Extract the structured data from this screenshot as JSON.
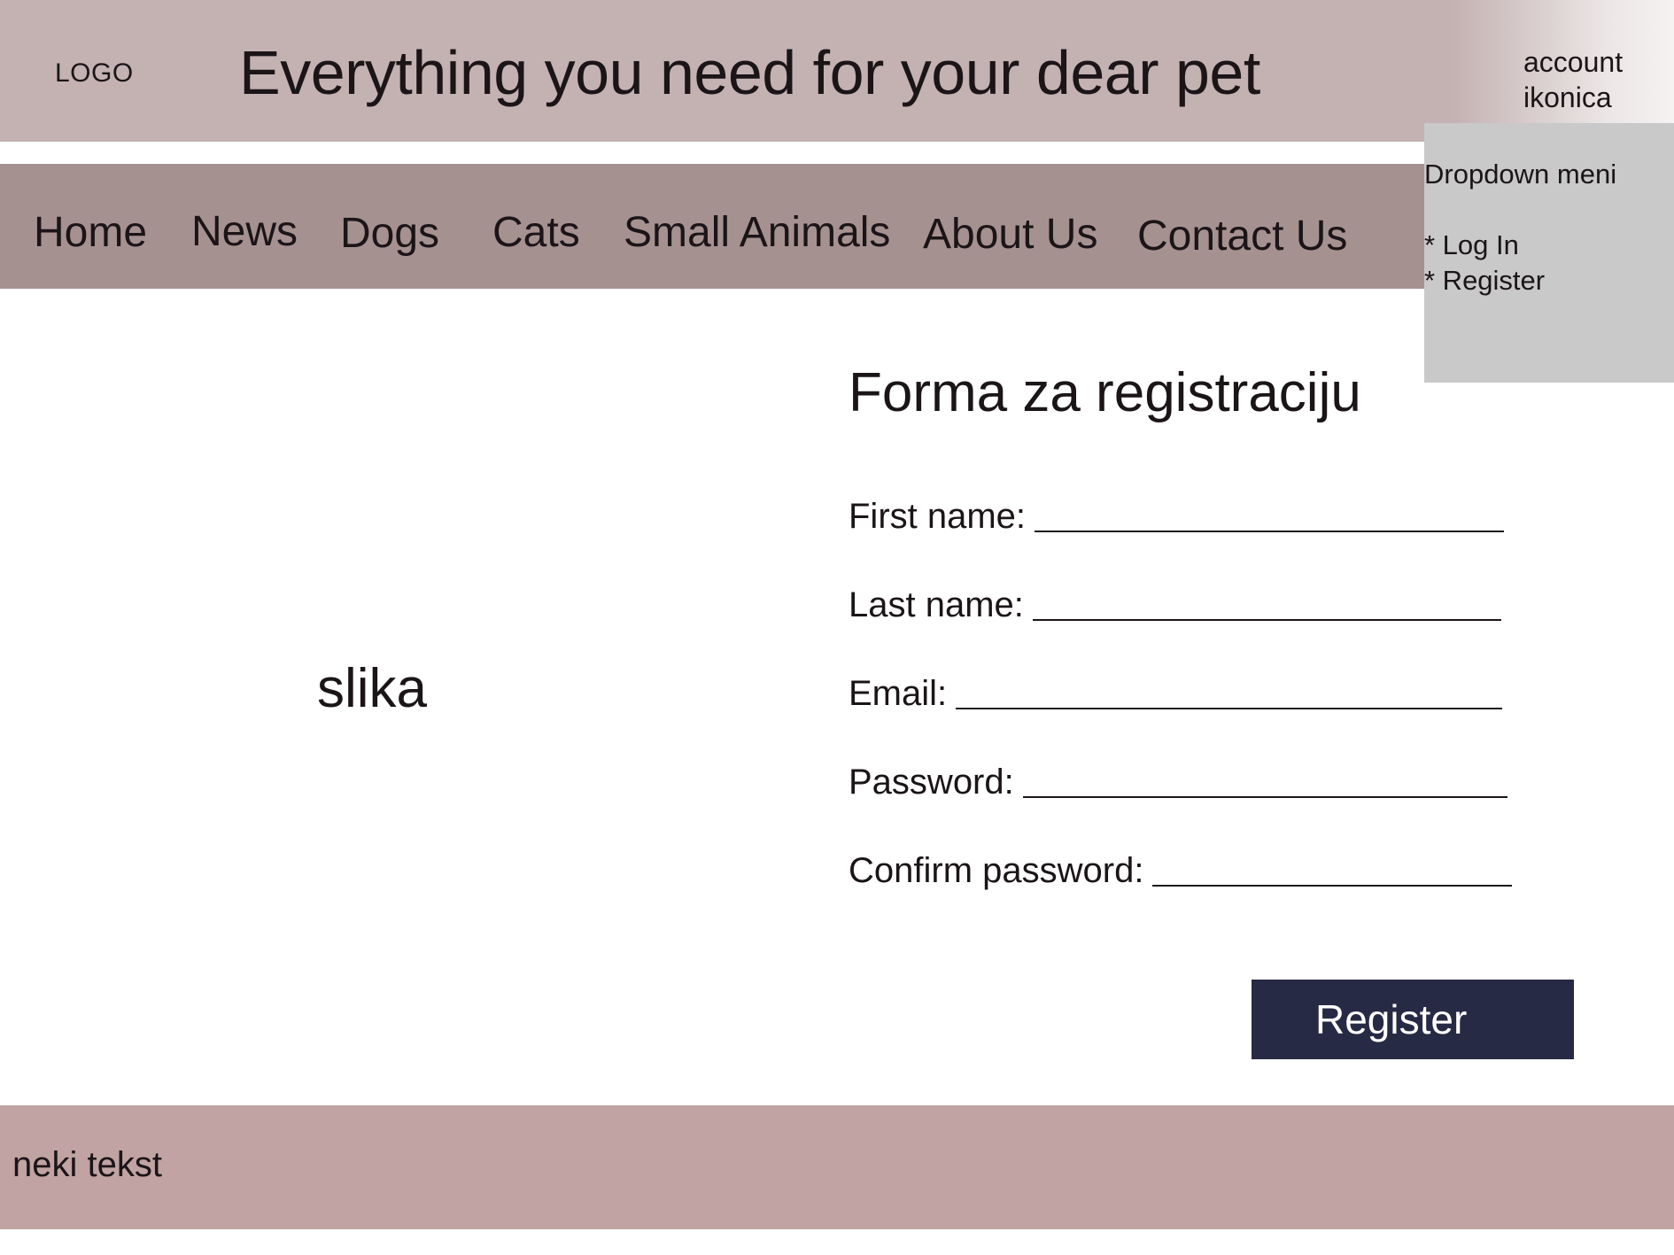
{
  "header": {
    "logo_text": "LOGO",
    "title": "Everything you need for your dear pet",
    "account_icon_line1": "account",
    "account_icon_line2": "ikonica"
  },
  "nav": {
    "items": [
      {
        "label": "Home"
      },
      {
        "label": "News"
      },
      {
        "label": "Dogs"
      },
      {
        "label": "Cats"
      },
      {
        "label": "Small Animals"
      },
      {
        "label": "About Us"
      },
      {
        "label": "Contact Us"
      }
    ]
  },
  "dropdown": {
    "title": "Dropdown meni",
    "items": [
      {
        "label": "* Log In"
      },
      {
        "label": "* Register"
      }
    ]
  },
  "main": {
    "image_placeholder": "slika",
    "form": {
      "title": "Forma za registraciju",
      "fields": [
        {
          "label": "First name:",
          "value": ""
        },
        {
          "label": "Last name:",
          "value": ""
        },
        {
          "label": "Email:",
          "value": ""
        },
        {
          "label": "Password:",
          "value": ""
        },
        {
          "label": "Confirm password:",
          "value": ""
        }
      ],
      "submit_label": "Register"
    }
  },
  "footer": {
    "text": "neki tekst"
  },
  "colors": {
    "header_bg": "#c4b2b2",
    "nav_bg": "#a69191",
    "dropdown_bg": "#c9c9c9",
    "button_bg": "#272a44",
    "footer_bg": "#c1a3a3"
  }
}
